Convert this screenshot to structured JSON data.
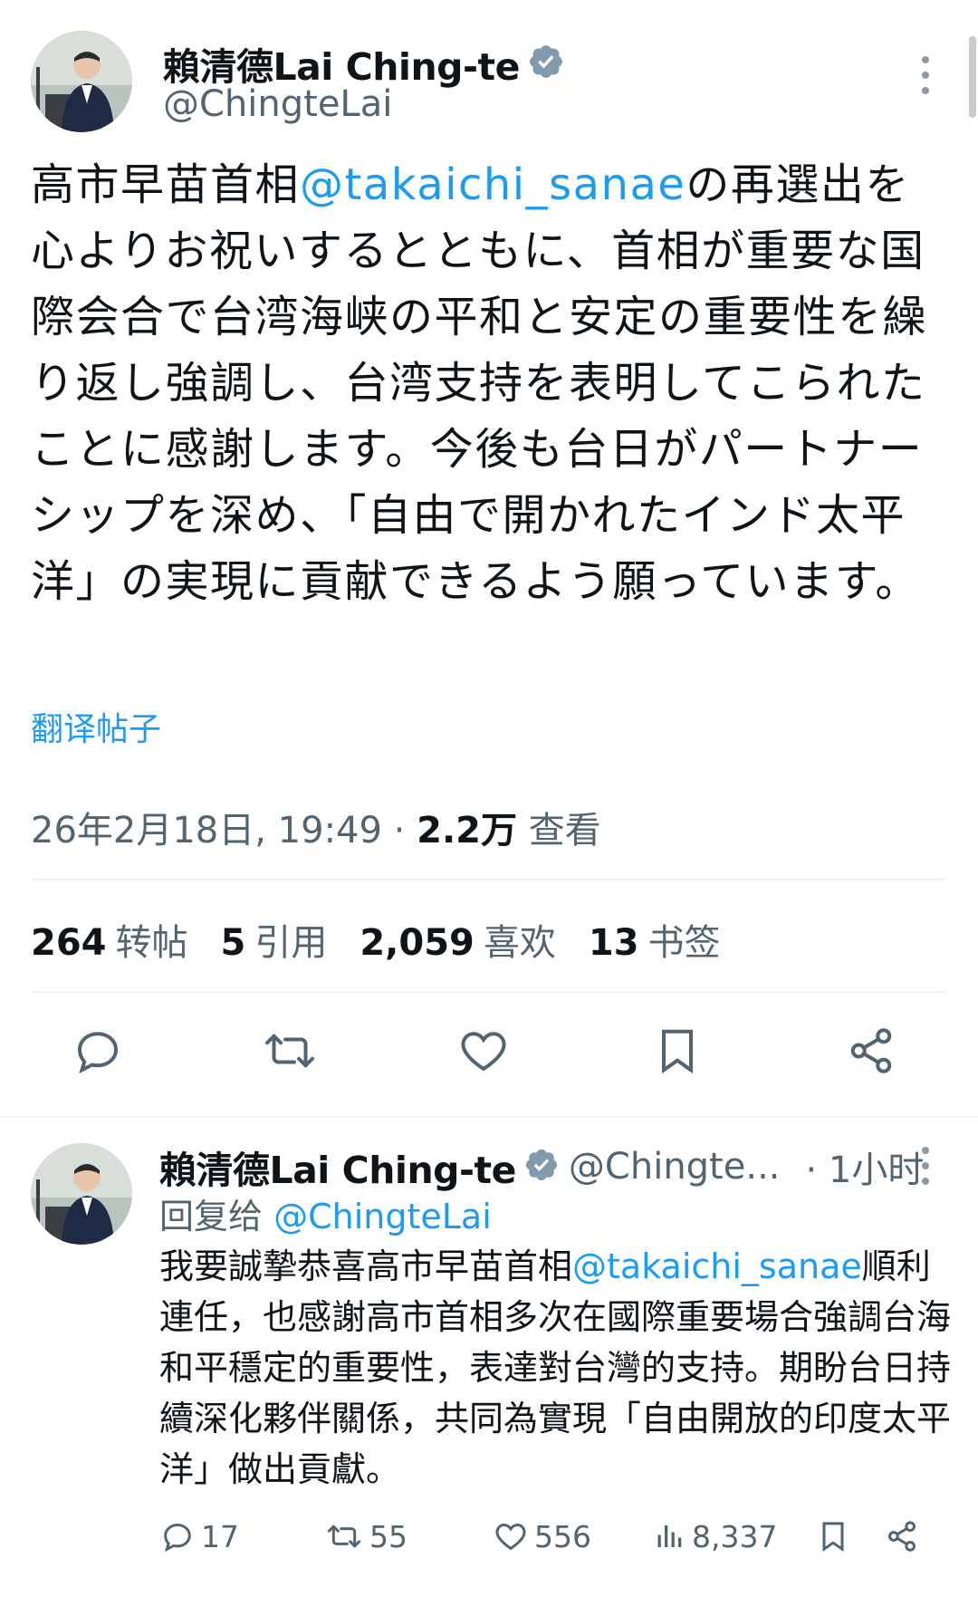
{
  "main_tweet": {
    "author_name": "賴清德Lai Ching-te",
    "author_handle": "@ChingteLai",
    "text_before": "高市早苗首相",
    "mention": "@takaichi_sanae",
    "text_after": "の再選出を心よりお祝いするとともに、首相が重要な国際会合で台湾海峡の平和と安定の重要性を繰り返し強調し、台湾支持を表明してこられたことに感謝します。今後も台日がパートナーシップを深め、「自由で開かれたインド太平洋」の実現に貢献できるよう願っています。",
    "translate_label": "翻译帖子",
    "timestamp": "26年2月18日, 19:49",
    "separator": "·",
    "views_count": "2.2万",
    "views_label": "查看",
    "stats": [
      {
        "count": "264",
        "label": "转帖"
      },
      {
        "count": "5",
        "label": "引用"
      },
      {
        "count": "2,059",
        "label": "喜欢"
      },
      {
        "count": "13",
        "label": "书签"
      }
    ],
    "actions": [
      "reply-icon",
      "retweet-icon",
      "like-icon",
      "bookmark-icon",
      "share-icon"
    ]
  },
  "reply_tweet": {
    "author_name": "賴清德Lai Ching-te",
    "author_handle": "@Chingte...",
    "time": "· 1小时",
    "reply_to_prefix": "回复给 ",
    "reply_to_handle": "@ChingteLai",
    "text_before": "我要誠摯恭喜高市早苗首相",
    "mention": "@takaichi_sanae",
    "text_after": "順利連任，也感謝高市首相多次在國際重要場合強調台海和平穩定的重要性，表達對台灣的支持。期盼台日持續深化夥伴關係，共同為實現「自由開放的印度太平洋」做出貢獻。",
    "replies": "17",
    "retweets": "55",
    "likes": "556",
    "views": "8,337"
  },
  "colors": {
    "accent": "#1d9bf0",
    "secondary_text": "#536471",
    "divider": "#eff3f4",
    "verified_badge": "#829aab"
  }
}
